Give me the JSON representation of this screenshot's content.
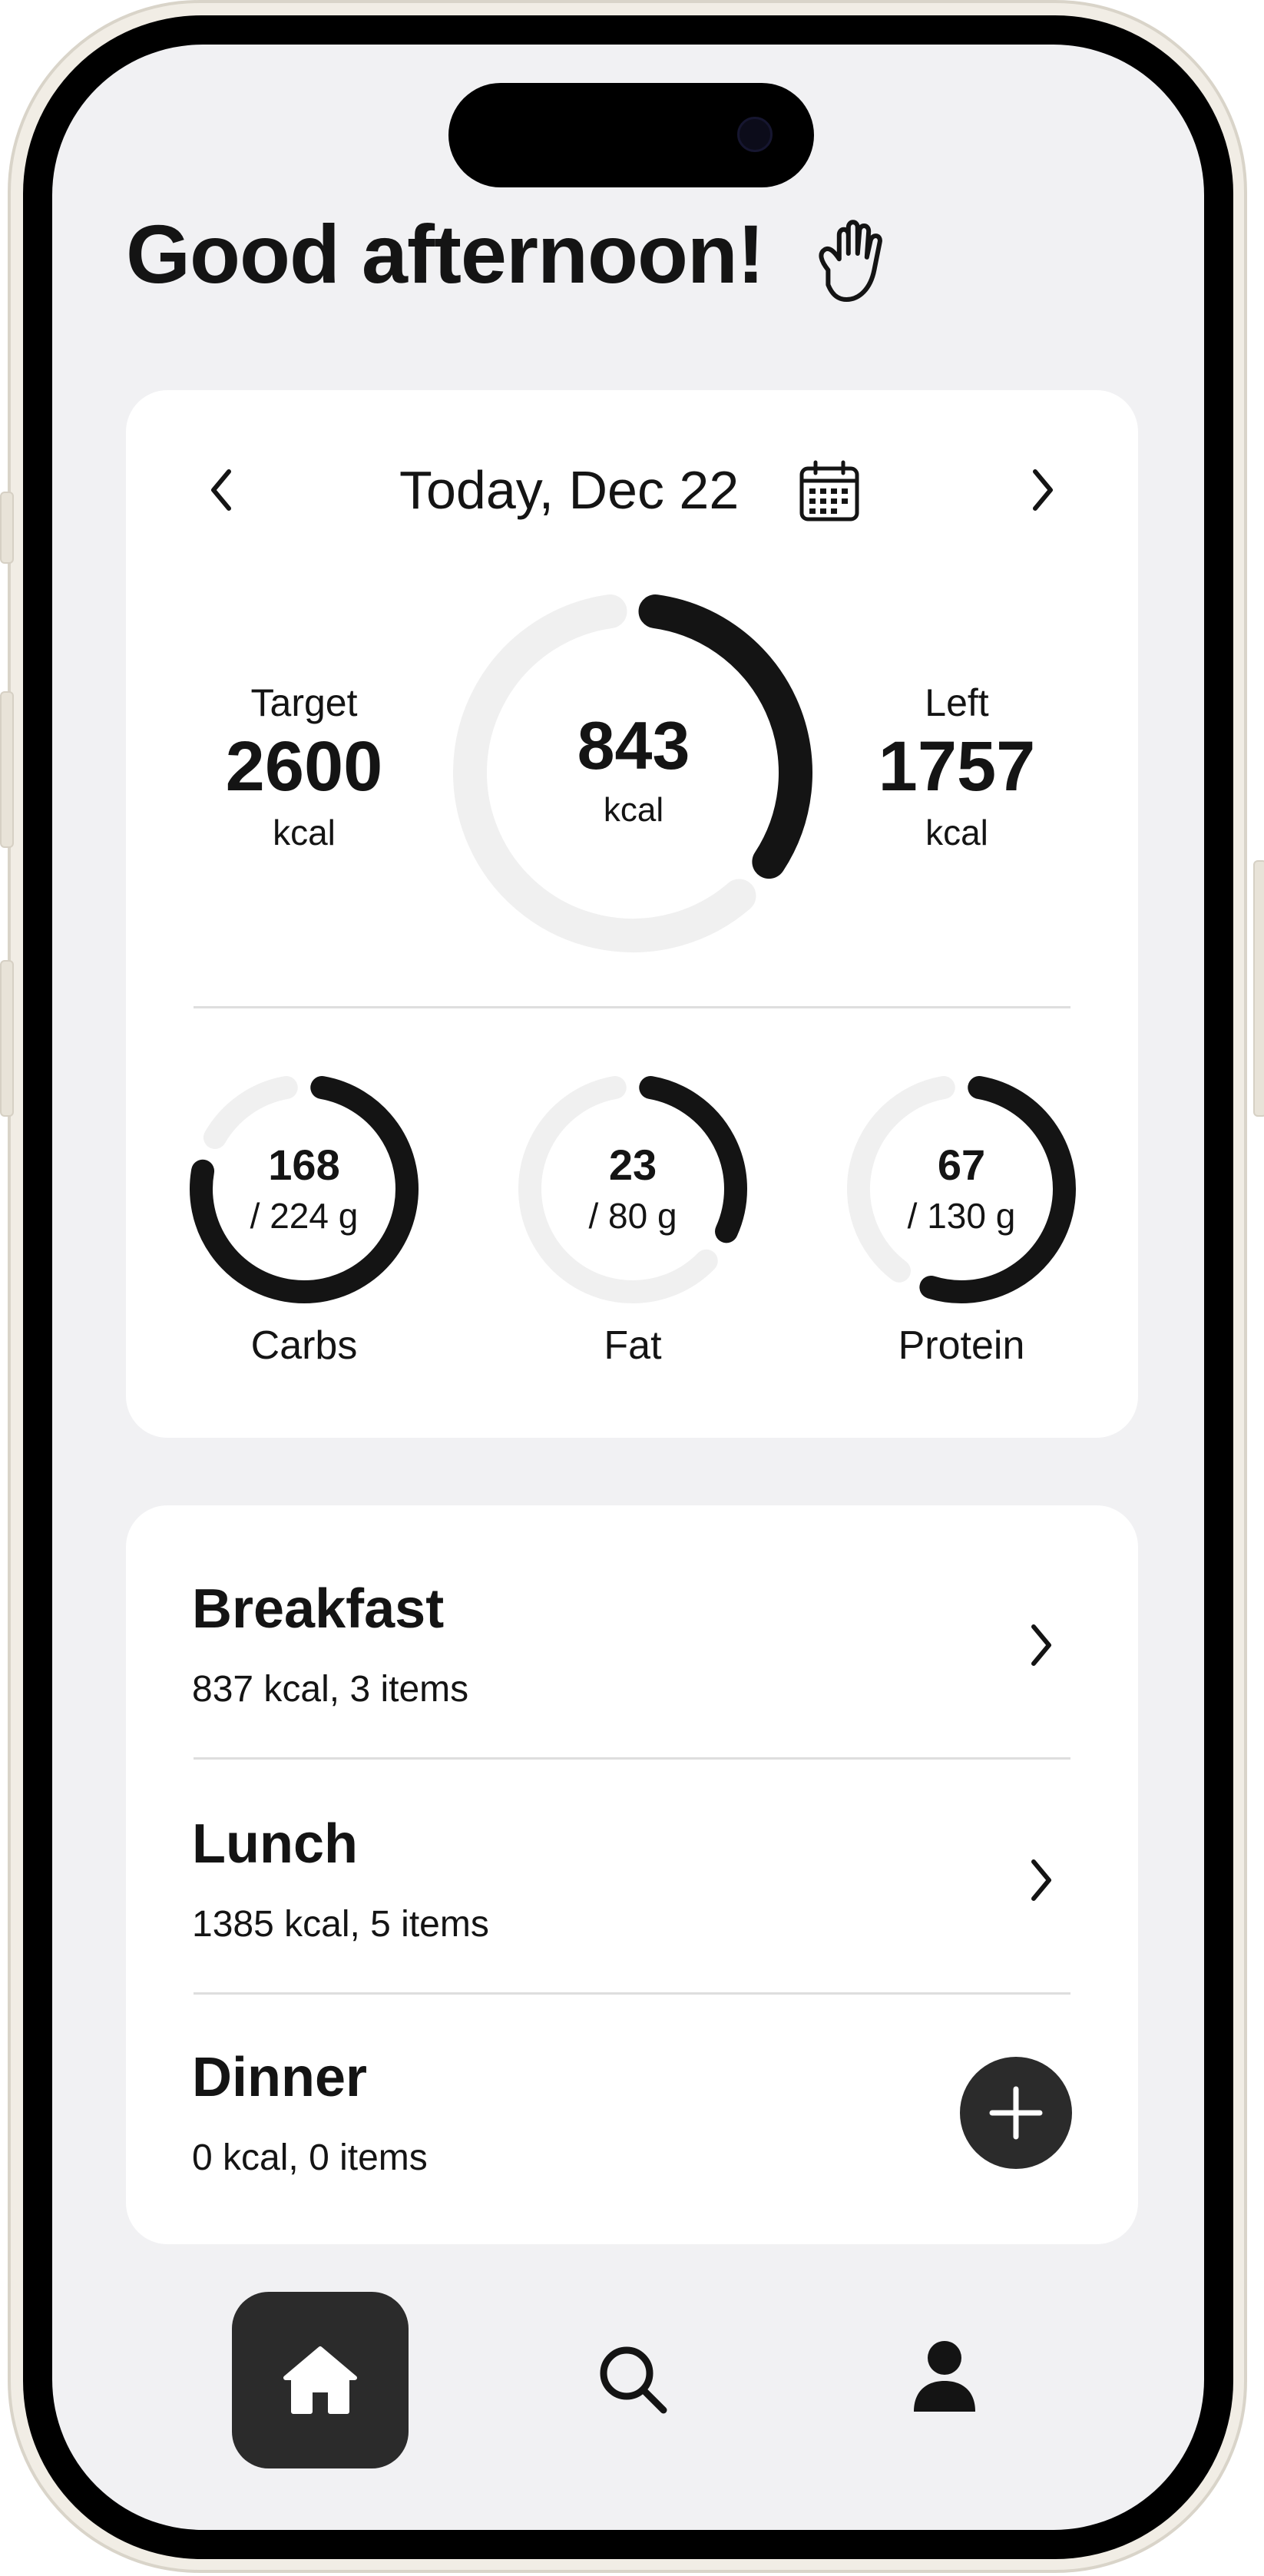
{
  "greeting": "Good afternoon!",
  "date_label": "Today, Dec 22",
  "calories": {
    "target_label": "Target",
    "target_value": "2600",
    "target_unit": "kcal",
    "consumed_value": "843",
    "consumed_unit": "kcal",
    "left_label": "Left",
    "left_value": "1757",
    "left_unit": "kcal",
    "progress": 0.32
  },
  "macros": [
    {
      "name": "Carbs",
      "value": "168",
      "goal": "/ 224 g",
      "progress": 0.75
    },
    {
      "name": "Fat",
      "value": "23",
      "goal": "/ 80 g",
      "progress": 0.29
    },
    {
      "name": "Protein",
      "value": "67",
      "goal": "/ 130 g",
      "progress": 0.52
    }
  ],
  "meals": [
    {
      "title": "Breakfast",
      "summary": "837 kcal, 3 items"
    },
    {
      "title": "Lunch",
      "summary": "1385 kcal, 5 items"
    },
    {
      "title": "Dinner",
      "summary": "0 kcal, 0 items"
    }
  ],
  "icons": {
    "wave": "waving-hand-icon",
    "prev": "chevron-left-icon",
    "next": "chevron-right-icon",
    "calendar": "calendar-icon",
    "add": "plus-icon",
    "home": "home-icon",
    "search": "search-icon",
    "profile": "user-icon"
  },
  "colors": {
    "background": "#f1f1f3",
    "card": "#ffffff",
    "accent": "#141414",
    "ring_track": "#f0f0f0"
  }
}
